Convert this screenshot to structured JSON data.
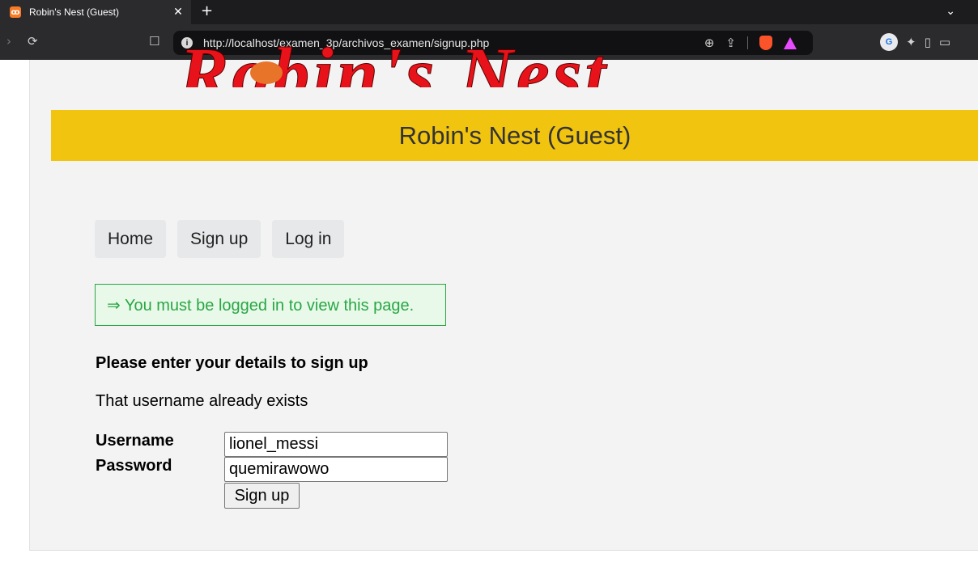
{
  "browser": {
    "tab_title": "Robin's Nest (Guest)",
    "tab_close": "✕",
    "new_tab": "+",
    "tab_menu": "⌄",
    "url": "http://localhost/examen_3p/archivos_examen/signup.php",
    "favicon_glyph": "ꝏ",
    "translate_glyph": "G"
  },
  "page": {
    "logo_text": "Robin's Nest",
    "header_title": "Robin's Nest (Guest)",
    "nav": [
      {
        "label": "Home"
      },
      {
        "label": "Sign up"
      },
      {
        "label": "Log in"
      }
    ],
    "notice": "⇒ You must be logged in to view this page.",
    "form": {
      "heading": "Please enter your details to sign up",
      "error": "That username already exists",
      "username_label": "Username",
      "username_value": "lionel_messi",
      "password_label": "Password",
      "password_value": "quemirawowo",
      "submit_label": "Sign up"
    }
  },
  "colors": {
    "header_band": "#f1c40f",
    "notice_green": "#28a745",
    "logo_red": "#e8131a"
  }
}
